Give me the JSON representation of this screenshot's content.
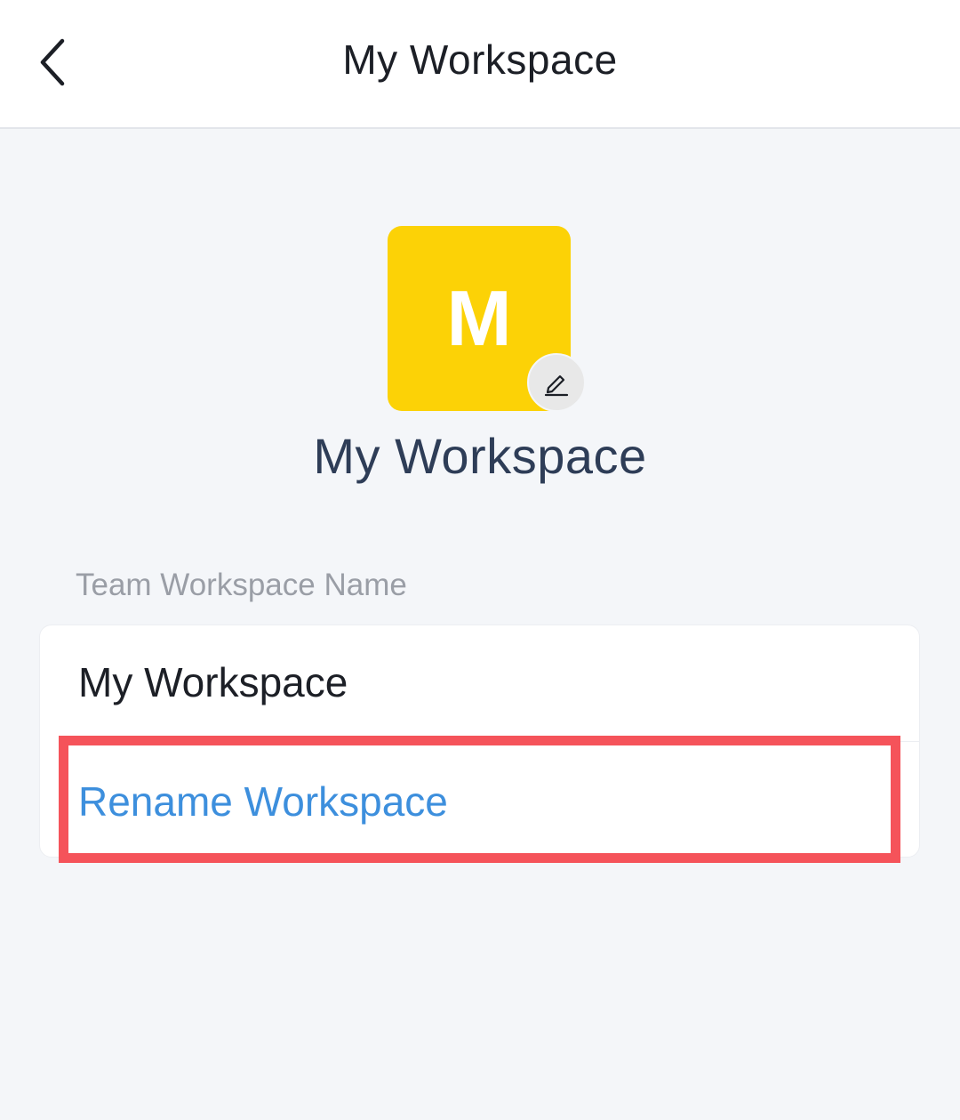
{
  "header": {
    "title": "My Workspace",
    "back_icon": "chevron-left-icon"
  },
  "workspace": {
    "avatar_letter": "M",
    "avatar_color": "#fcd206",
    "edit_icon": "pencil-icon",
    "name": "My Workspace"
  },
  "name_section": {
    "label": "Team Workspace Name",
    "value": "My Workspace",
    "rename_label": "Rename Workspace"
  },
  "colors": {
    "accent": "#3d8fdd",
    "highlight": "#f5535a"
  }
}
